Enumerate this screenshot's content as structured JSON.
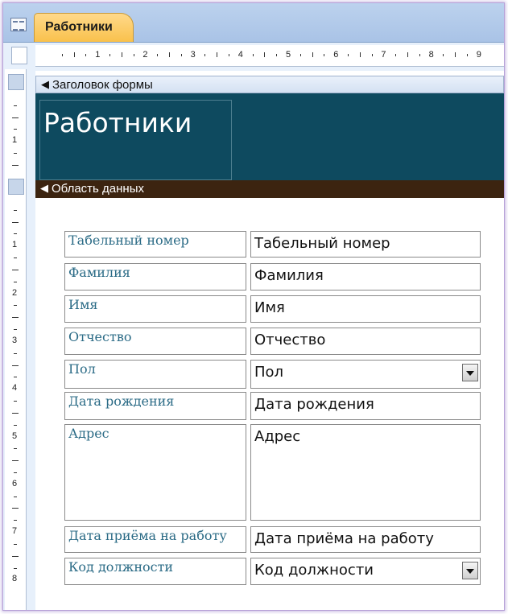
{
  "tab": {
    "label": "Работники"
  },
  "ruler": {
    "h_numbers": [
      "1",
      "2",
      "3",
      "4",
      "5",
      "6",
      "7",
      "8",
      "9"
    ],
    "v_header_numbers": [
      "1"
    ],
    "v_data_numbers": [
      "1",
      "2",
      "3",
      "4",
      "5",
      "6",
      "7",
      "8"
    ]
  },
  "sections": {
    "header_label": "Заголовок формы",
    "data_label": "Область данных"
  },
  "form_title": "Работники",
  "fields": [
    {
      "label": "Табельный номер",
      "value": "Табельный номер",
      "kind": "text"
    },
    {
      "label": "Фамилия",
      "value": "Фамилия",
      "kind": "text"
    },
    {
      "label": "Имя",
      "value": "Имя",
      "kind": "text"
    },
    {
      "label": "Отчество",
      "value": "Отчество",
      "kind": "text"
    },
    {
      "label": "Пол",
      "value": "Пол",
      "kind": "combo"
    },
    {
      "label": "Дата рождения",
      "value": "Дата рождения",
      "kind": "text"
    },
    {
      "label": "Адрес",
      "value": "Адрес",
      "kind": "memo"
    },
    {
      "label": "Дата приёма на работу",
      "value": "Дата приёма на работу",
      "kind": "text"
    },
    {
      "label": "Код должности",
      "value": "Код должности",
      "kind": "combo"
    }
  ],
  "colors": {
    "header_band": "#0e4a5f",
    "data_bar": "#3c2410",
    "label_text": "#2b6b86",
    "tab": "#f9c14c"
  }
}
